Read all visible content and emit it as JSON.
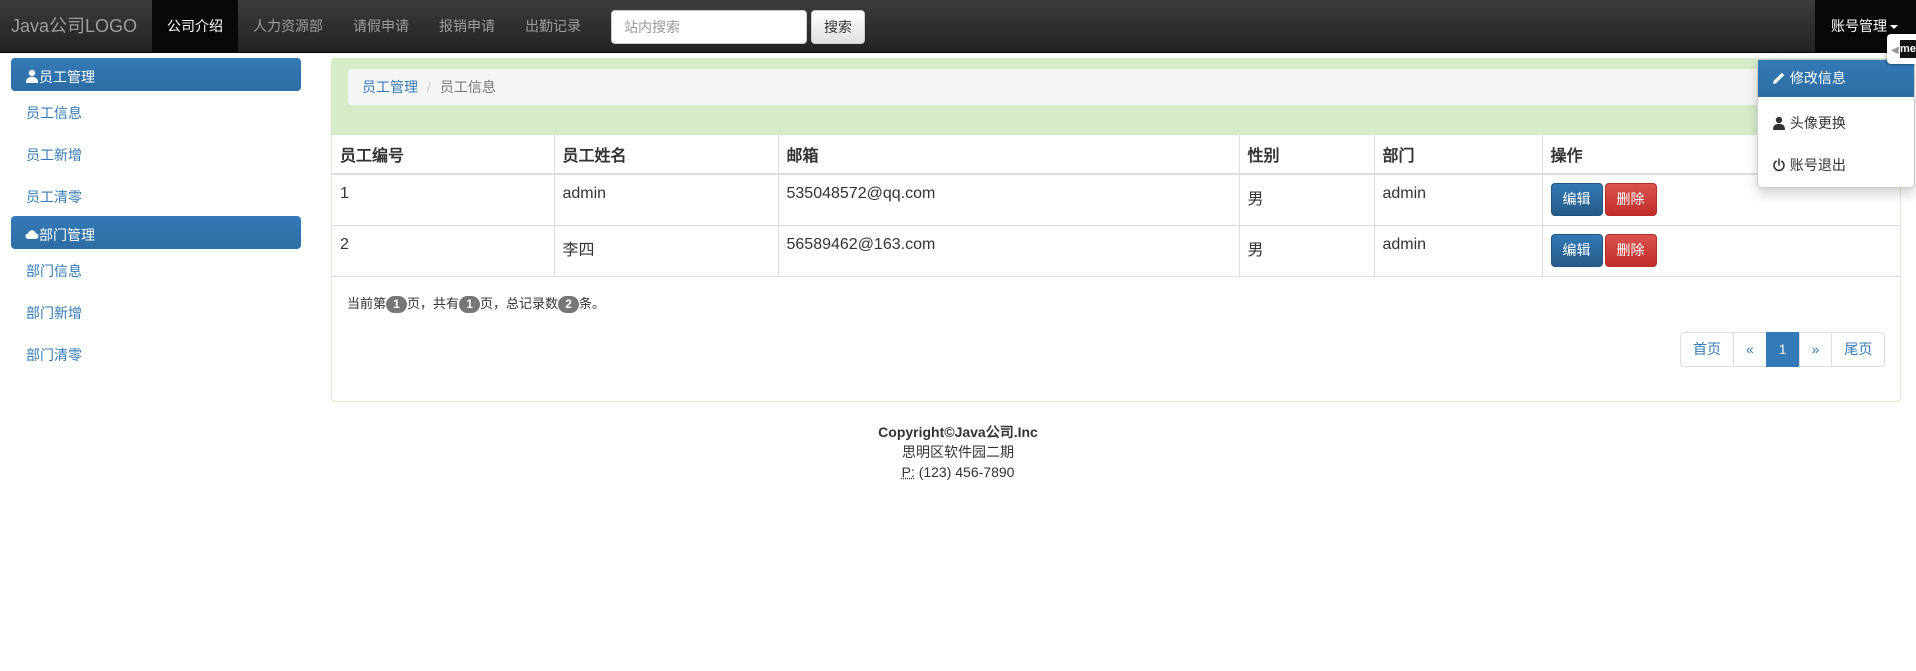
{
  "navbar": {
    "brand": "Java公司LOGO",
    "items": [
      {
        "label": "公司介绍",
        "active": true
      },
      {
        "label": "人力资源部",
        "active": false
      },
      {
        "label": "请假申请",
        "active": false
      },
      {
        "label": "报销申请",
        "active": false
      },
      {
        "label": "出勤记录",
        "active": false
      }
    ],
    "search_placeholder": "站内搜索",
    "search_button": "搜索",
    "account_menu": "账号管理"
  },
  "sidebar": {
    "groups": [
      {
        "title": "员工管理",
        "icon": "user-icon",
        "items": [
          "员工信息",
          "员工新增",
          "员工清零"
        ]
      },
      {
        "title": "部门管理",
        "icon": "cloud-icon",
        "items": [
          "部门信息",
          "部门新增",
          "部门清零"
        ]
      }
    ]
  },
  "breadcrumb": {
    "parent": "员工管理",
    "separator": "/",
    "current": "员工信息"
  },
  "table": {
    "headers": [
      "员工编号",
      "员工姓名",
      "邮箱",
      "性别",
      "部门",
      "操作"
    ],
    "rows": [
      {
        "id": "1",
        "name": "admin",
        "email": "535048572@qq.com",
        "gender": "男",
        "dept": "admin"
      },
      {
        "id": "2",
        "name": "李四",
        "email": "56589462@163.com",
        "gender": "男",
        "dept": "admin"
      }
    ],
    "edit_label": "编辑",
    "delete_label": "删除"
  },
  "pageinfo": {
    "prefix": "当前第",
    "current_page": "1",
    "mid1": "页，共有",
    "total_pages": "1",
    "mid2": "页，总记录数",
    "total_records": "2",
    "suffix": "条。"
  },
  "pagination": {
    "first": "首页",
    "prev": "«",
    "current": "1",
    "next": "»",
    "last": "尾页"
  },
  "footer": {
    "copyright": "Copyright©Java公司.Inc",
    "address": "思明区软件园二期",
    "phone_abbr": "P:",
    "phone": "(123) 456-7890"
  },
  "dropdown": {
    "items": [
      {
        "label": "修改信息",
        "icon": "pencil-icon",
        "active": true
      },
      {
        "label": "头像更换",
        "icon": "user-icon",
        "active": false
      },
      {
        "label": "账号退出",
        "icon": "power-icon",
        "active": false
      }
    ]
  },
  "edge_tab": {
    "arrow": "◀",
    "text": "me"
  },
  "colors": {
    "primary": "#337ab7",
    "danger": "#d9534f",
    "panel_heading": "#d6ecc8",
    "navbar": "#222222"
  }
}
